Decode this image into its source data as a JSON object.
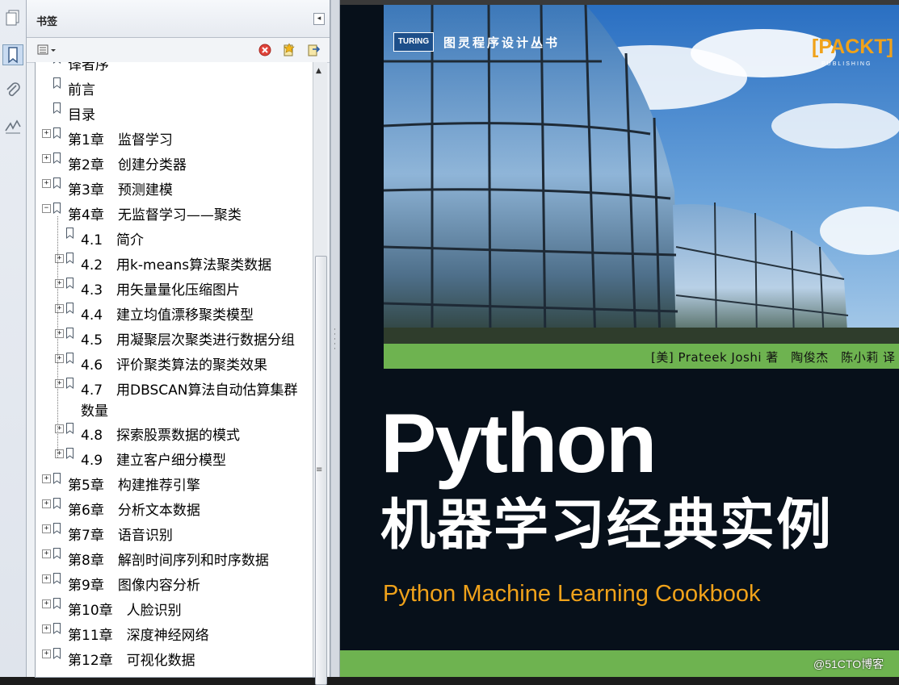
{
  "bookmarks_panel": {
    "title": "书签",
    "collapse_glyph": "◂"
  },
  "bookmarks": [
    {
      "label": "译者序",
      "expander": "",
      "level": 0
    },
    {
      "label": "前言",
      "expander": "",
      "level": 0
    },
    {
      "label": "目录",
      "expander": "",
      "level": 0
    },
    {
      "label": "第1章　监督学习",
      "expander": "+",
      "level": 0
    },
    {
      "label": "第2章　创建分类器",
      "expander": "+",
      "level": 0
    },
    {
      "label": "第3章　预测建模",
      "expander": "+",
      "level": 0
    },
    {
      "label": "第4章　无监督学习——聚类",
      "expander": "−",
      "level": 0
    },
    {
      "label": "4.1　简介",
      "expander": "",
      "level": 1
    },
    {
      "label": "4.2　用k-means算法聚类数据",
      "expander": "+",
      "level": 1
    },
    {
      "label": "4.3　用矢量量化压缩图片",
      "expander": "+",
      "level": 1
    },
    {
      "label": "4.4　建立均值漂移聚类模型",
      "expander": "+",
      "level": 1
    },
    {
      "label": "4.5　用凝聚层次聚类进行数据分组",
      "expander": "+",
      "level": 1
    },
    {
      "label": "4.6　评价聚类算法的聚类效果",
      "expander": "+",
      "level": 1
    },
    {
      "label": "4.7　用DBSCAN算法自动估算集群",
      "expander": "+",
      "level": 1,
      "continuation": "数量"
    },
    {
      "label": "4.8　探索股票数据的模式",
      "expander": "+",
      "level": 1
    },
    {
      "label": "4.9　建立客户细分模型",
      "expander": "+",
      "level": 1
    },
    {
      "label": "第5章　构建推荐引擎",
      "expander": "+",
      "level": 0
    },
    {
      "label": "第6章　分析文本数据",
      "expander": "+",
      "level": 0
    },
    {
      "label": "第7章　语音识别",
      "expander": "+",
      "level": 0
    },
    {
      "label": "第8章　解剖时间序列和时序数据",
      "expander": "+",
      "level": 0
    },
    {
      "label": "第9章　图像内容分析",
      "expander": "+",
      "level": 0
    },
    {
      "label": "第10章　人脸识别",
      "expander": "+",
      "level": 0
    },
    {
      "label": "第11章　深度神经网络",
      "expander": "+",
      "level": 0
    },
    {
      "label": "第12章　可视化数据",
      "expander": "+",
      "level": 0
    }
  ],
  "cover": {
    "publisher_badge": "TURING",
    "series": "图灵程序设计丛书",
    "brand": "[PACKT]",
    "brand_sub": "PUBLISHING",
    "authors": "[美] Prateek Joshi 著　陶俊杰　陈小莉 译",
    "title_en": "Python",
    "title_cn": "机器学习经典实例",
    "subtitle": "Python Machine Learning Cookbook"
  },
  "watermark": "@51CTO博客",
  "colors": {
    "accent_green": "#6eb350",
    "accent_orange": "#f0a21a",
    "cover_dark": "#07101a"
  }
}
